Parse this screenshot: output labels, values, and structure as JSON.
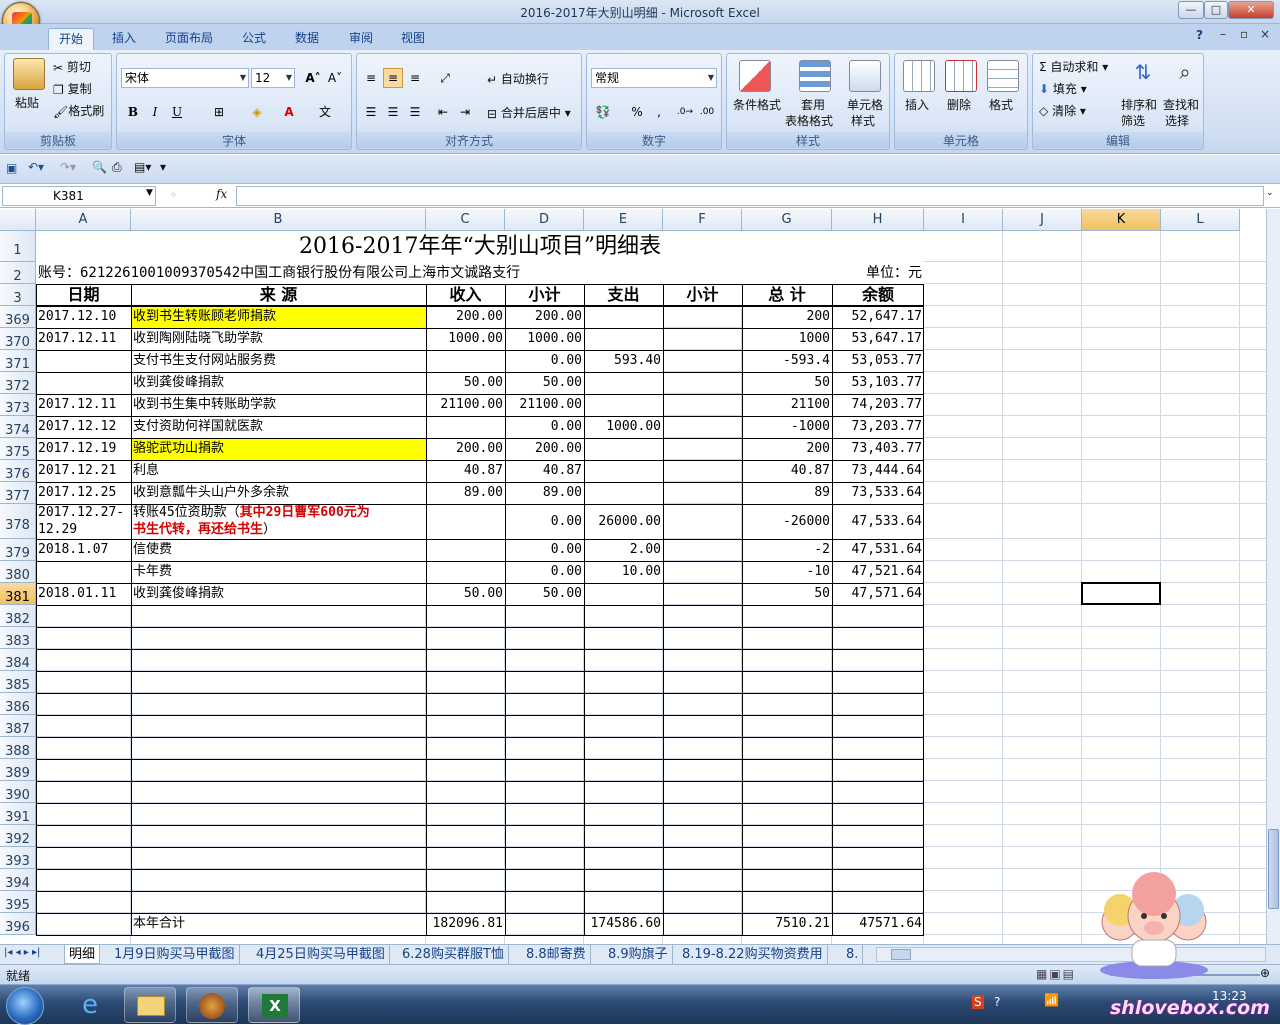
{
  "window": {
    "title": "2016-2017年大别山明细 - Microsoft Excel"
  },
  "ribbon": {
    "tabs": [
      "开始",
      "插入",
      "页面布局",
      "公式",
      "数据",
      "审阅",
      "视图"
    ],
    "clipboard": {
      "paste": "粘贴",
      "cut": "剪切",
      "copy": "复制",
      "format_painter": "格式刷",
      "label": "剪贴板"
    },
    "font": {
      "name": "宋体",
      "size": "12",
      "label": "字体",
      "bold": "B",
      "italic": "I",
      "underline": "U"
    },
    "alignment": {
      "wrap": "自动换行",
      "merge": "合并后居中",
      "label": "对齐方式"
    },
    "number": {
      "format": "常规",
      "percent": "%",
      "comma": ",",
      "label": "数字"
    },
    "styles": {
      "conditional": "条件格式",
      "table": "套用",
      "table2": "表格格式",
      "cell": "单元格",
      "cell2": "样式",
      "label": "样式"
    },
    "cells": {
      "insert": "插入",
      "delete": "删除",
      "format": "格式",
      "label": "单元格"
    },
    "editing": {
      "autosum": "自动求和",
      "fill": "填充",
      "clear": "清除",
      "sort": "排序和",
      "sort2": "筛选",
      "find": "查找和",
      "find2": "选择",
      "label": "编辑"
    }
  },
  "formula_bar": {
    "name_box": "K381",
    "fx": "fx",
    "content": ""
  },
  "columns": [
    "A",
    "B",
    "C",
    "D",
    "E",
    "F",
    "G",
    "H",
    "I",
    "J",
    "K",
    "L"
  ],
  "sheet": {
    "title": "2016-2017年年“大别山项目”明细表",
    "account": "账号：6212261001009370542中国工商银行股份有限公司上海市文诚路支行",
    "unit": "单位：元",
    "headers": {
      "date": "日期",
      "source": "来  源",
      "income": "收入",
      "subtotal1": "小计",
      "expense": "支出",
      "subtotal2": "小计",
      "total": "总  计",
      "balance": "余额"
    },
    "rows": [
      {
        "n": "369",
        "date": "2017.12.10",
        "src": "收到书生转账顾老师捐款",
        "inc": "200.00",
        "sub": "200.00",
        "exp": "",
        "tot": "200",
        "bal": "52,647.17",
        "hl": true
      },
      {
        "n": "370",
        "date": "2017.12.11",
        "src": "收到陶刚陆晓飞助学款",
        "inc": "1000.00",
        "sub": "1000.00",
        "exp": "",
        "tot": "1000",
        "bal": "53,647.17"
      },
      {
        "n": "371",
        "date": "",
        "src": "支付书生支付网站服务费",
        "inc": "",
        "sub": "0.00",
        "exp": "593.40",
        "tot": "-593.4",
        "bal": "53,053.77"
      },
      {
        "n": "372",
        "date": "",
        "src": "收到龚俊峰捐款",
        "inc": "50.00",
        "sub": "50.00",
        "exp": "",
        "tot": "50",
        "bal": "53,103.77"
      },
      {
        "n": "373",
        "date": "2017.12.11",
        "src": "收到书生集中转账助学款",
        "inc": "21100.00",
        "sub": "21100.00",
        "exp": "",
        "tot": "21100",
        "bal": "74,203.77"
      },
      {
        "n": "374",
        "date": "2017.12.12",
        "src": "支付资助何祥国就医款",
        "inc": "",
        "sub": "0.00",
        "exp": "1000.00",
        "tot": "-1000",
        "bal": "73,203.77"
      },
      {
        "n": "375",
        "date": "2017.12.19",
        "src": "骆驼武功山捐款",
        "inc": "200.00",
        "sub": "200.00",
        "exp": "",
        "tot": "200",
        "bal": "73,403.77",
        "hl": true
      },
      {
        "n": "376",
        "date": "2017.12.21",
        "src": "利息",
        "inc": "40.87",
        "sub": "40.87",
        "exp": "",
        "tot": "40.87",
        "bal": "73,444.64"
      },
      {
        "n": "377",
        "date": "2017.12.25",
        "src": "收到意瓢牛头山户外多余款",
        "inc": "89.00",
        "sub": "89.00",
        "exp": "",
        "tot": "89",
        "bal": "73,533.64"
      },
      {
        "n": "378",
        "date": "2017.12.27-",
        "date2": "12.29",
        "src": "转账45位资助款（",
        "src_red": "其中29日曹军600元为",
        "src2_red": "书生代转，再还给书生",
        "src2_end": "）",
        "inc": "",
        "sub": "0.00",
        "exp": "26000.00",
        "tot": "-26000",
        "bal": "47,533.64",
        "tall": true
      },
      {
        "n": "379",
        "date": "2018.1.07",
        "src": "信使费",
        "inc": "",
        "sub": "0.00",
        "exp": "2.00",
        "tot": "-2",
        "bal": "47,531.64"
      },
      {
        "n": "380",
        "date": "",
        "src": "卡年费",
        "inc": "",
        "sub": "0.00",
        "exp": "10.00",
        "tot": "-10",
        "bal": "47,521.64"
      },
      {
        "n": "381",
        "date": "2018.01.11",
        "src": "收到龚俊峰捐款",
        "inc": "50.00",
        "sub": "50.00",
        "exp": "",
        "tot": "50",
        "bal": "47,571.64"
      }
    ],
    "empty_rows": [
      "382",
      "383",
      "384",
      "385",
      "386",
      "387",
      "388",
      "389",
      "390",
      "391",
      "392",
      "393",
      "394",
      "395"
    ],
    "total_row": {
      "n": "396",
      "src": "本年合计",
      "inc": "182096.81",
      "exp": "174586.60",
      "tot": "7510.21",
      "bal": "47571.64"
    }
  },
  "sheet_tabs": [
    "明细",
    "1月9日购买马甲截图",
    "4月25日购买马甲截图",
    "6.28购买群服T恤",
    "8.8邮寄费",
    "8.9购旗子",
    "8.19-8.22购买物资费用",
    "8."
  ],
  "status": {
    "ready": "就绪"
  },
  "taskbar": {
    "time": "13:23",
    "watermark": "shlovebox.com"
  }
}
